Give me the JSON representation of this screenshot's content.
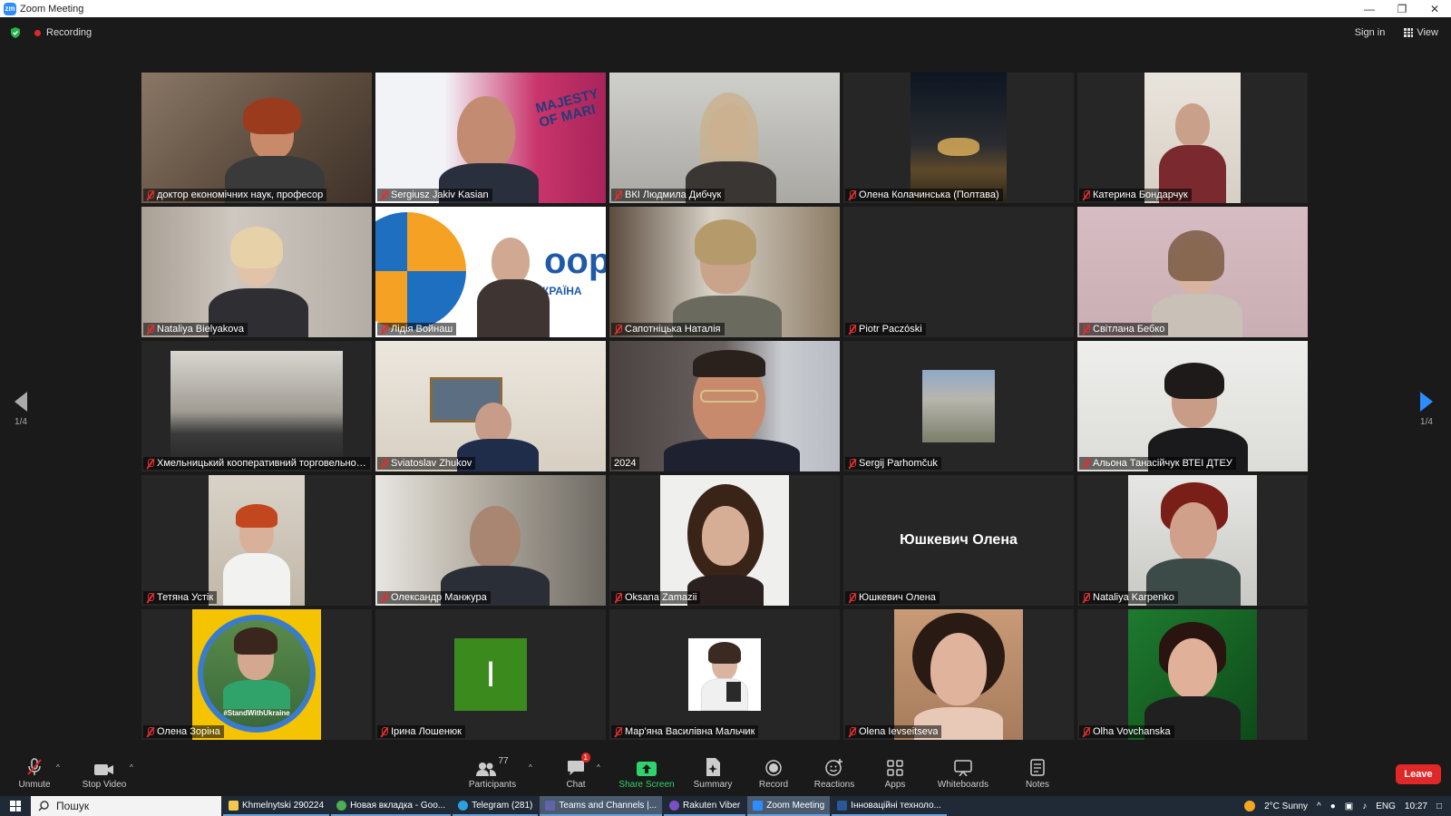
{
  "window": {
    "title": "Zoom Meeting",
    "logo_text": "zm"
  },
  "topbar": {
    "recording_label": "Recording",
    "signin_label": "Sign in",
    "view_label": "View"
  },
  "pager": {
    "left_page": "1/4",
    "right_page": "1/4"
  },
  "participants": [
    {
      "name": "доктор економічних наук, професор",
      "muted": true
    },
    {
      "name": "Sergiusz Jakiv Kasian",
      "muted": true
    },
    {
      "name": "ВКІ Людмила Дибчук",
      "muted": true
    },
    {
      "name": "Олена Колачинська (Полтава)",
      "muted": true
    },
    {
      "name": "Катерина Бондарчук",
      "muted": true
    },
    {
      "name": "Nataliya Bielyakova",
      "muted": true
    },
    {
      "name": "Лідія Войнаш",
      "muted": true
    },
    {
      "name": "Сапотніцька Наталія",
      "muted": true
    },
    {
      "name": "Piotr Paczóski",
      "muted": true
    },
    {
      "name": "Світлана Бебко",
      "muted": true
    },
    {
      "name": "Хмельницький кооперативний торговельно-...",
      "muted": true
    },
    {
      "name": "Sviatoslav Zhukov",
      "muted": true
    },
    {
      "name": "2024",
      "muted": false,
      "active_speaker": true
    },
    {
      "name": "Sergij Parhomčuk",
      "muted": true
    },
    {
      "name": "Альона Танасійчук ВТЕІ ДТЕУ",
      "muted": true
    },
    {
      "name": "Тетяна Устік",
      "muted": true
    },
    {
      "name": "Олександр Манжура",
      "muted": true
    },
    {
      "name": "Oksana Zamazii",
      "muted": true
    },
    {
      "name": "Юшкевич Олена",
      "muted": true,
      "card_text": "Юшкевич Олена"
    },
    {
      "name": "Nataliya Karpenko",
      "muted": true
    },
    {
      "name": "Олена Зоріна",
      "muted": true,
      "badge_text": "#StandWithUkraine"
    },
    {
      "name": "Ірина Лошенюк",
      "muted": true,
      "initial": "I"
    },
    {
      "name": "Мар'яна Василівна Мальчик",
      "muted": true
    },
    {
      "name": "Olena Ievseitseva",
      "muted": true
    },
    {
      "name": "Olha Vovchanska",
      "muted": true
    }
  ],
  "tile_extras": {
    "poster_text": "MAJESTY OF MARI",
    "coop_text": "oop",
    "coop_sub": "КРАЇНА"
  },
  "toolbar": {
    "unmute": "Unmute",
    "stop_video": "Stop Video",
    "participants": "Participants",
    "participants_count": "77",
    "chat": "Chat",
    "chat_badge": "1",
    "share_screen": "Share Screen",
    "summary": "Summary",
    "record": "Record",
    "reactions": "Reactions",
    "apps": "Apps",
    "whiteboards": "Whiteboards",
    "notes": "Notes",
    "leave": "Leave"
  },
  "taskbar": {
    "search_placeholder": "Пошук",
    "items": [
      {
        "label": "Khmelnytski 290224",
        "color": "#f2c94c"
      },
      {
        "label": "Новая вкладка - Goo...",
        "color": "#4caf50"
      },
      {
        "label": "Telegram (281)",
        "color": "#2aa3e0"
      },
      {
        "label": "Teams and Channels |...",
        "color": "#6264a7"
      },
      {
        "label": "Rakuten Viber",
        "color": "#7d4fc6"
      },
      {
        "label": "Zoom Meeting",
        "color": "#2d8cff"
      },
      {
        "label": "Інноваційні техноло...",
        "color": "#2b5797"
      }
    ],
    "weather": "2°C  Sunny",
    "language": "ENG",
    "time": "10:27"
  }
}
